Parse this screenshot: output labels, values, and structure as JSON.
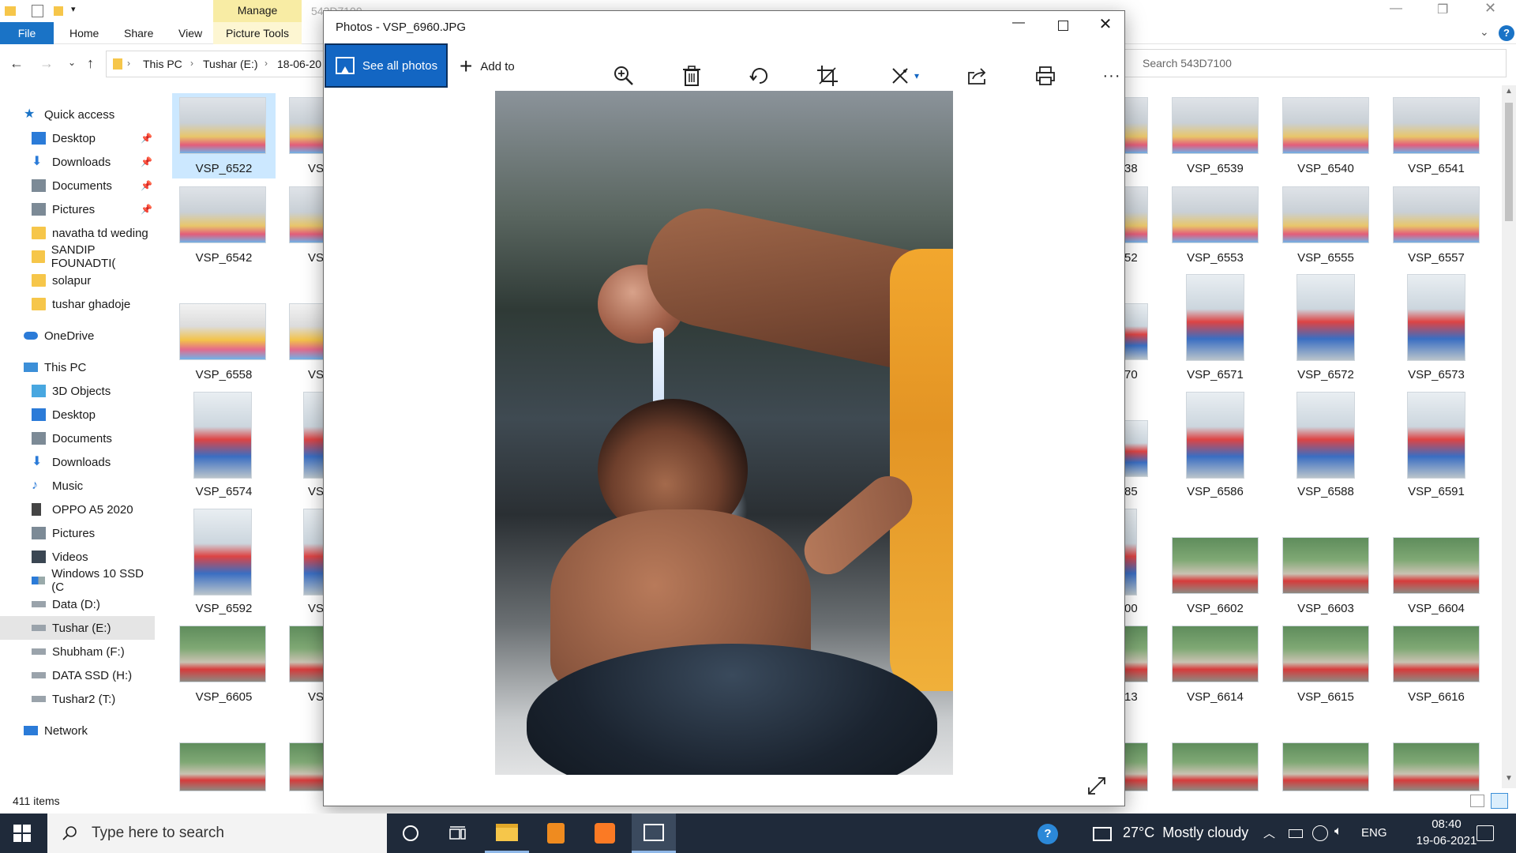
{
  "explorer": {
    "ribbon": {
      "manage": "Manage",
      "picture_tools": "Picture Tools",
      "file": "File",
      "home": "Home",
      "share": "Share",
      "view": "View",
      "window_title": "543D7100"
    },
    "breadcrumb": [
      "This PC",
      "Tushar (E:)",
      "18-06-20"
    ],
    "search_placeholder": "Search 543D7100",
    "status": "411 items",
    "nav": {
      "quick_access": "Quick access",
      "qa_items": [
        "Desktop",
        "Downloads",
        "Documents",
        "Pictures",
        "navatha td weding",
        "SANDIP FOUNADTI(",
        "solapur",
        "tushar ghadoje"
      ],
      "onedrive": "OneDrive",
      "this_pc": "This PC",
      "pc_items": [
        "3D Objects",
        "Desktop",
        "Documents",
        "Downloads",
        "Music",
        "OPPO A5 2020",
        "Pictures",
        "Videos",
        "Windows 10 SSD (C",
        "Data (D:)",
        "Tushar (E:)",
        "Shubham (F:)",
        "DATA SSD (H:)",
        "Tushar2 (T:)"
      ],
      "network": "Network"
    },
    "left_files": [
      "VSP_6522",
      "VSP_6542",
      "VSP_6558",
      "VSP_6574",
      "VSP_6592",
      "VSP_6605"
    ],
    "col2_partial": [
      "VS",
      "VS",
      "VS",
      "VS",
      "VS",
      "VS"
    ],
    "partial_right": [
      "38",
      "52",
      "70",
      "85",
      "00",
      "13"
    ],
    "right_files": [
      [
        "VSP_6539",
        "VSP_6540",
        "VSP_6541"
      ],
      [
        "VSP_6553",
        "VSP_6555",
        "VSP_6557"
      ],
      [
        "VSP_6571",
        "VSP_6572",
        "VSP_6573"
      ],
      [
        "VSP_6586",
        "VSP_6588",
        "VSP_6591"
      ],
      [
        "VSP_6602",
        "VSP_6603",
        "VSP_6604"
      ],
      [
        "VSP_6614",
        "VSP_6615",
        "VSP_6616"
      ]
    ]
  },
  "photos": {
    "title": "Photos - VSP_6960.JPG",
    "see_all": "See all photos",
    "add_to": "Add to"
  },
  "taskbar": {
    "search_placeholder": "Type here to search",
    "weather": "27°C  Mostly cloudy",
    "lang": "ENG",
    "time": "08:40",
    "date": "19-06-2021"
  }
}
